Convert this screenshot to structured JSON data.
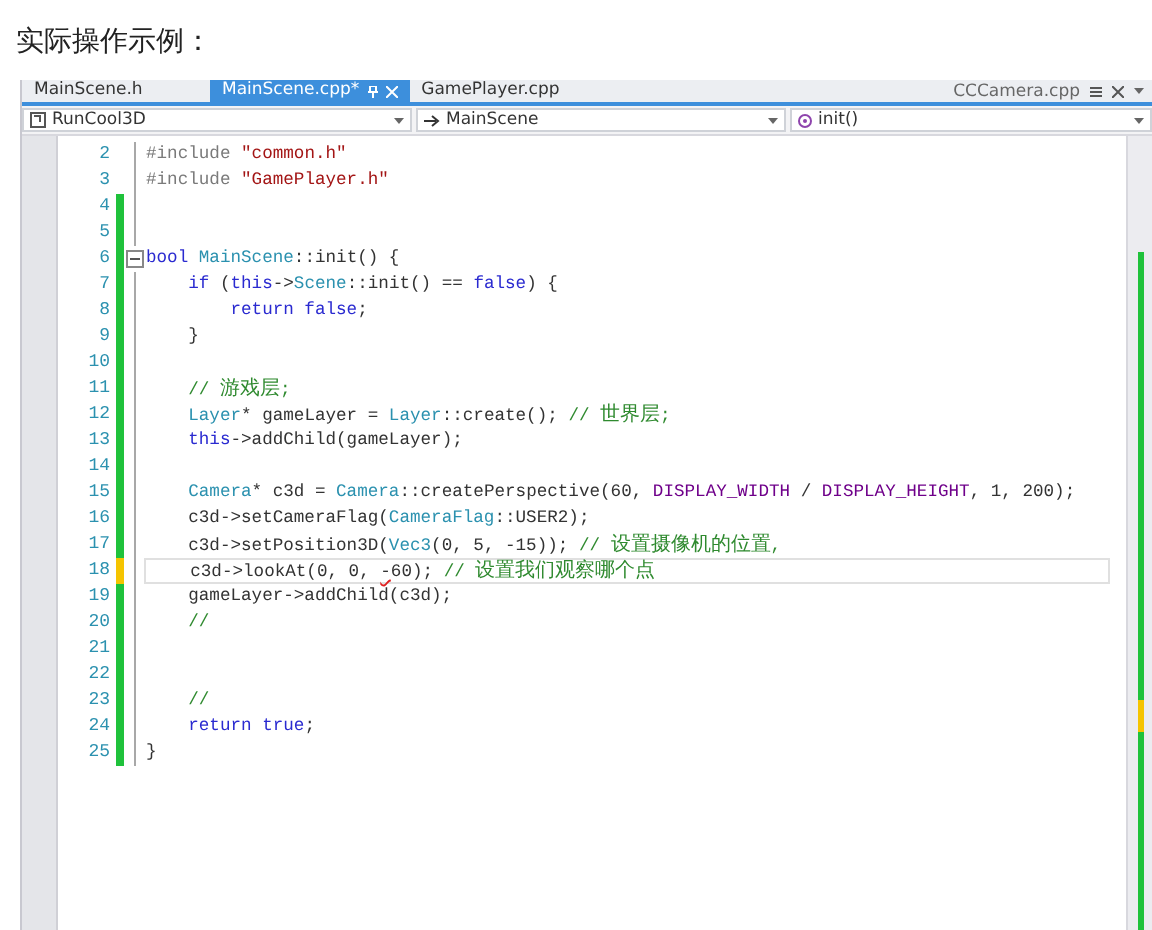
{
  "heading": "实际操作示例：",
  "tabs": [
    {
      "label": "MainScene.h",
      "selected": false
    },
    {
      "label": "MainScene.cpp*",
      "selected": true
    },
    {
      "label": "GamePlayer.cpp",
      "selected": false
    }
  ],
  "preview_tab": {
    "label": "CCCamera.cpp"
  },
  "nav": [
    {
      "kind": "project",
      "value": "RunCool3D"
    },
    {
      "kind": "class",
      "value": "MainScene"
    },
    {
      "kind": "method",
      "value": "init()"
    }
  ],
  "lines": [
    {
      "number": "2",
      "kind": "original",
      "collapsible": false,
      "current": false,
      "tokens": [
        {
          "kind": "preproc",
          "text": "#include "
        },
        {
          "kind": "string",
          "text": "\"common.h\""
        }
      ]
    },
    {
      "number": "3",
      "kind": "original",
      "collapsible": false,
      "current": false,
      "tokens": [
        {
          "kind": "preproc",
          "text": "#include "
        },
        {
          "kind": "string",
          "text": "\"GamePlayer.h\""
        }
      ]
    },
    {
      "number": "4",
      "kind": "saved-change",
      "collapsible": false,
      "current": false
    },
    {
      "number": "5",
      "kind": "saved-change",
      "collapsible": false,
      "current": false
    },
    {
      "number": "6",
      "kind": "saved-change",
      "collapsible": true,
      "current": false,
      "tokens": [
        {
          "kind": "keyword",
          "text": "bool "
        },
        {
          "kind": "type",
          "text": "MainScene"
        },
        {
          "kind": "plain",
          "text": "::init() {"
        }
      ]
    },
    {
      "number": "7",
      "kind": "saved-change",
      "collapsible": false,
      "current": false,
      "tokens": [
        {
          "kind": "keyword",
          "text": "    if "
        },
        {
          "kind": "plain",
          "text": "("
        },
        {
          "kind": "keyword",
          "text": "this"
        },
        {
          "kind": "plain",
          "text": "->"
        },
        {
          "kind": "type",
          "text": "Scene"
        },
        {
          "kind": "plain",
          "text": "::init() == "
        },
        {
          "kind": "keyword",
          "text": "false"
        },
        {
          "kind": "plain",
          "text": ") {"
        }
      ]
    },
    {
      "number": "8",
      "kind": "saved-change",
      "collapsible": false,
      "current": false,
      "tokens": [
        {
          "kind": "keyword",
          "text": "        return false"
        },
        {
          "kind": "plain",
          "text": ";"
        }
      ]
    },
    {
      "number": "9",
      "kind": "saved-change",
      "collapsible": false,
      "current": false,
      "tokens": [
        {
          "kind": "plain",
          "text": "    }"
        }
      ]
    },
    {
      "number": "10",
      "kind": "saved-change",
      "collapsible": false,
      "current": false
    },
    {
      "number": "11",
      "kind": "saved-change",
      "collapsible": false,
      "current": false,
      "tokens": [
        {
          "kind": "comment",
          "text": "    // 游戏层;"
        }
      ]
    },
    {
      "number": "12",
      "kind": "saved-change",
      "collapsible": false,
      "current": false,
      "tokens": [
        {
          "kind": "type",
          "text": "    Layer"
        },
        {
          "kind": "plain",
          "text": "* gameLayer = "
        },
        {
          "kind": "type",
          "text": "Layer"
        },
        {
          "kind": "plain",
          "text": "::create(); "
        },
        {
          "kind": "comment",
          "text": "// 世界层;"
        }
      ]
    },
    {
      "number": "13",
      "kind": "saved-change",
      "collapsible": false,
      "current": false,
      "tokens": [
        {
          "kind": "keyword",
          "text": "    this"
        },
        {
          "kind": "plain",
          "text": "->addChild(gameLayer);"
        }
      ]
    },
    {
      "number": "14",
      "kind": "saved-change",
      "collapsible": false,
      "current": false
    },
    {
      "number": "15",
      "kind": "saved-change",
      "collapsible": false,
      "current": false,
      "tokens": [
        {
          "kind": "type",
          "text": "    Camera"
        },
        {
          "kind": "plain",
          "text": "* c3d = "
        },
        {
          "kind": "type",
          "text": "Camera"
        },
        {
          "kind": "plain",
          "text": "::createPerspective(60, "
        },
        {
          "kind": "macro",
          "text": "DISPLAY_WIDTH"
        },
        {
          "kind": "plain",
          "text": " / "
        },
        {
          "kind": "macro",
          "text": "DISPLAY_HEIGHT"
        },
        {
          "kind": "plain",
          "text": ", 1, 200);"
        }
      ]
    },
    {
      "number": "16",
      "kind": "saved-change",
      "collapsible": false,
      "current": false,
      "tokens": [
        {
          "kind": "plain",
          "text": "    c3d->setCameraFlag("
        },
        {
          "kind": "type",
          "text": "CameraFlag"
        },
        {
          "kind": "plain",
          "text": "::USER2);"
        }
      ]
    },
    {
      "number": "17",
      "kind": "saved-change",
      "collapsible": false,
      "current": false,
      "tokens": [
        {
          "kind": "plain",
          "text": "    c3d->setPosition3D("
        },
        {
          "kind": "type",
          "text": "Vec3"
        },
        {
          "kind": "plain",
          "text": "(0, 5, -15)); "
        },
        {
          "kind": "comment",
          "text": "// 设置摄像机的位置,"
        }
      ]
    },
    {
      "number": "18",
      "kind": "unsaved-change",
      "collapsible": false,
      "current": true,
      "tokens": [
        {
          "kind": "plain",
          "text": "    c3d->lookAt(0, 0, "
        },
        {
          "kind": "error",
          "text": "-"
        },
        {
          "kind": "plain",
          "text": "60); "
        },
        {
          "kind": "comment",
          "text": "// 设置我们观察哪个点"
        }
      ]
    },
    {
      "number": "19",
      "kind": "saved-change",
      "collapsible": false,
      "current": false,
      "tokens": [
        {
          "kind": "plain",
          "text": "    gameLayer->addChild(c3d);"
        }
      ]
    },
    {
      "number": "20",
      "kind": "saved-change",
      "collapsible": false,
      "current": false,
      "tokens": [
        {
          "kind": "comment",
          "text": "    //"
        }
      ]
    },
    {
      "number": "21",
      "kind": "saved-change",
      "collapsible": false,
      "current": false
    },
    {
      "number": "22",
      "kind": "saved-change",
      "collapsible": false,
      "current": false
    },
    {
      "number": "23",
      "kind": "saved-change",
      "collapsible": false,
      "current": false,
      "tokens": [
        {
          "kind": "comment",
          "text": "    //"
        }
      ]
    },
    {
      "number": "24",
      "kind": "saved-change",
      "collapsible": false,
      "current": false,
      "tokens": [
        {
          "kind": "keyword",
          "text": "    return true"
        },
        {
          "kind": "plain",
          "text": ";"
        }
      ]
    },
    {
      "number": "25",
      "kind": "saved-change",
      "collapsible": false,
      "current": false,
      "tokens": [
        {
          "kind": "plain",
          "text": "}"
        }
      ]
    }
  ]
}
